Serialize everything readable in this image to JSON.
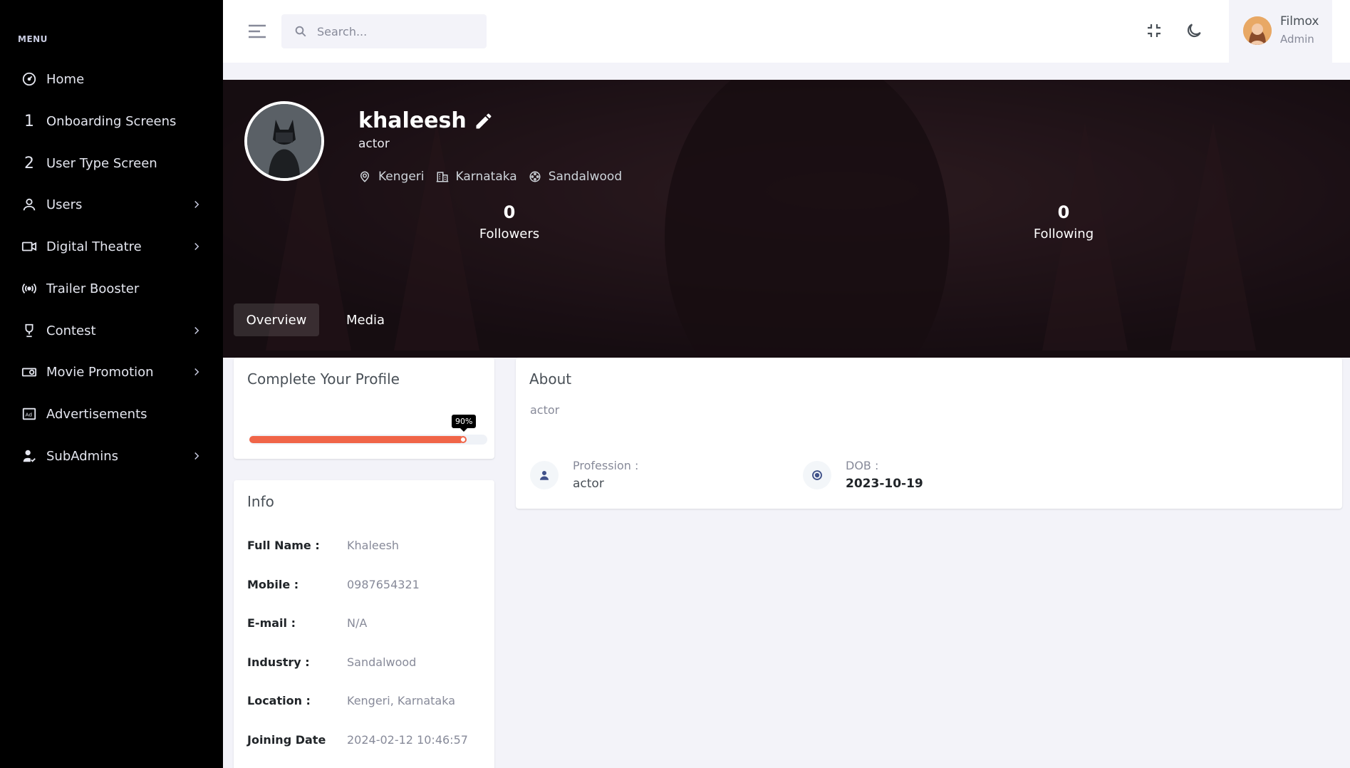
{
  "sidebar": {
    "menu_title": "MENU",
    "items": [
      {
        "label": "Home",
        "icon": "dashboard-icon"
      },
      {
        "label": "Onboarding Screens",
        "icon": "number-one-icon",
        "icon_text": "1"
      },
      {
        "label": "User Type Screen",
        "icon": "number-two-icon",
        "icon_text": "2"
      },
      {
        "label": "Users",
        "icon": "user-icon"
      },
      {
        "label": "Digital Theatre",
        "icon": "video-camera-icon"
      },
      {
        "label": "Trailer Booster",
        "icon": "broadcast-icon"
      },
      {
        "label": "Contest",
        "icon": "trophy-icon"
      },
      {
        "label": "Movie Promotion",
        "icon": "projector-icon"
      },
      {
        "label": "Advertisements",
        "icon": "ad-icon"
      },
      {
        "label": "SubAdmins",
        "icon": "user-check-icon"
      }
    ]
  },
  "header": {
    "search_placeholder": "Search...",
    "user": {
      "name": "Filmox",
      "role": "Admin"
    }
  },
  "profile": {
    "name": "khaleesh",
    "role": "actor",
    "meta": {
      "location": "Kengeri",
      "state": "Karnataka",
      "industry": "Sandalwood"
    },
    "followers": {
      "count": "0",
      "label": "Followers"
    },
    "following": {
      "count": "0",
      "label": "Following"
    },
    "tabs": [
      "Overview",
      "Media"
    ],
    "active_tab": "Overview"
  },
  "complete_profile": {
    "title": "Complete Your Profile",
    "percent": 90,
    "percent_label": "90%"
  },
  "info": {
    "title": "Info",
    "rows": [
      {
        "key": "Full Name :",
        "value": "Khaleesh"
      },
      {
        "key": "Mobile :",
        "value": "0987654321"
      },
      {
        "key": "E-mail :",
        "value": "N/A"
      },
      {
        "key": "Industry :",
        "value": "Sandalwood"
      },
      {
        "key": "Location :",
        "value": "Kengeri, Karnataka"
      },
      {
        "key": "Joining Date",
        "value": "2024-02-12 10:46:57"
      }
    ]
  },
  "about": {
    "title": "About",
    "text": "actor",
    "profession": {
      "label": "Profession :",
      "value": "actor"
    },
    "dob": {
      "label": "DOB :",
      "value": "2023-10-19"
    }
  },
  "colors": {
    "sidebar_bg": "#000000",
    "accent_progress": "#f06548",
    "page_bg": "#f3f3f9"
  }
}
